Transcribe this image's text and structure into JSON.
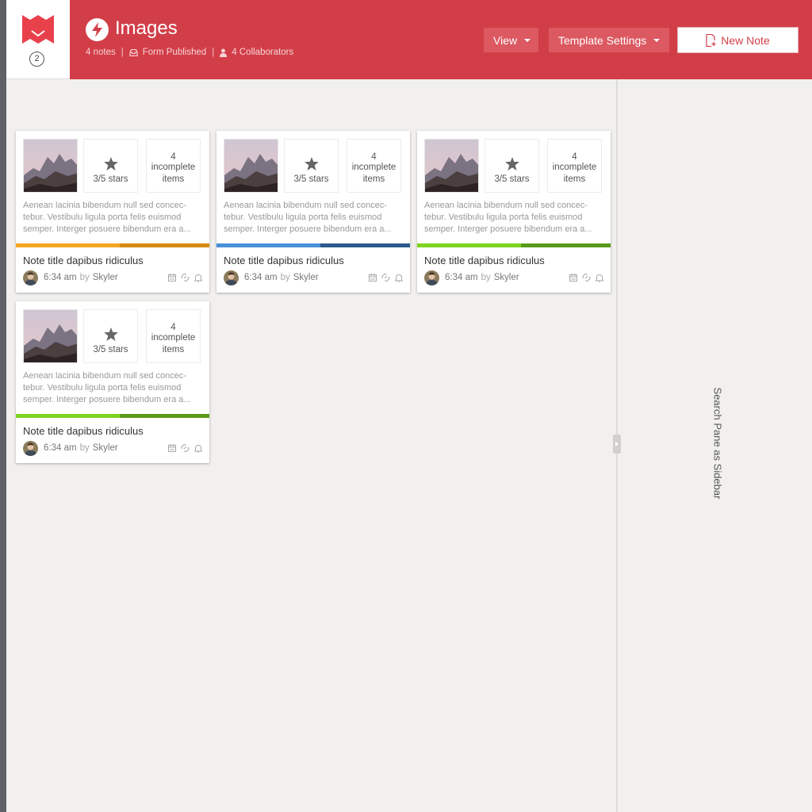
{
  "header": {
    "logo_badge": "2",
    "title": "Images",
    "meta": {
      "notes": "4 notes",
      "form_status": "Form Published",
      "collaborators": "4 Collaborators"
    },
    "view_button": "View",
    "template_button": "Template Settings",
    "new_note_button": "New Note",
    "accent_color": "#d23e48"
  },
  "sidebar": {
    "label": "Search Pane as Sidebar"
  },
  "cards": [
    {
      "stars": "3/5 stars",
      "incomplete_count": "4",
      "incomplete_label": "incomplete items",
      "excerpt": "Aenean lacinia bibendum null sed concec-tebur. Vestibulu ligula porta felis euismod semper. Interger posuere bibendum era a...",
      "bar_colors": [
        "#f5a623",
        "#d68910"
      ],
      "title": "Note title dapibus ridiculus",
      "time": "6:34 am",
      "by": "by",
      "author": "Skyler"
    },
    {
      "stars": "3/5 stars",
      "incomplete_count": "4",
      "incomplete_label": "incomplete items",
      "excerpt": "Aenean lacinia bibendum null sed concec-tebur. Vestibulu ligula porta felis euismod semper. Interger posuere bibendum era a...",
      "bar_colors": [
        "#4a90d9",
        "#2c5a8c"
      ],
      "title": "Note title dapibus ridiculus",
      "time": "6:34 am",
      "by": "by",
      "author": "Skyler"
    },
    {
      "stars": "3/5 stars",
      "incomplete_count": "4",
      "incomplete_label": "incomplete items",
      "excerpt": "Aenean lacinia bibendum null sed concec-tebur. Vestibulu ligula porta felis euismod semper. Interger posuere bibendum era a...",
      "bar_colors": [
        "#7ed321",
        "#5a9a1a"
      ],
      "title": "Note title dapibus ridiculus",
      "time": "6:34 am",
      "by": "by",
      "author": "Skyler"
    },
    {
      "stars": "3/5 stars",
      "incomplete_count": "4",
      "incomplete_label": "incomplete items",
      "excerpt": "Aenean lacinia bibendum null sed concec-tebur. Vestibulu ligula porta felis euismod semper. Interger posuere bibendum era a...",
      "bar_colors": [
        "#7ed321",
        "#5a9a1a"
      ],
      "title": "Note title dapibus ridiculus",
      "time": "6:34 am",
      "by": "by",
      "author": "Skyler"
    }
  ],
  "icons": {
    "logo": "banner-logo-icon",
    "title": "lightning-icon",
    "form": "inbox-icon",
    "collaborators": "user-icon",
    "new_note": "new-document-icon",
    "card_actions": [
      "calendar-icon",
      "link-icon",
      "bell-icon"
    ]
  }
}
